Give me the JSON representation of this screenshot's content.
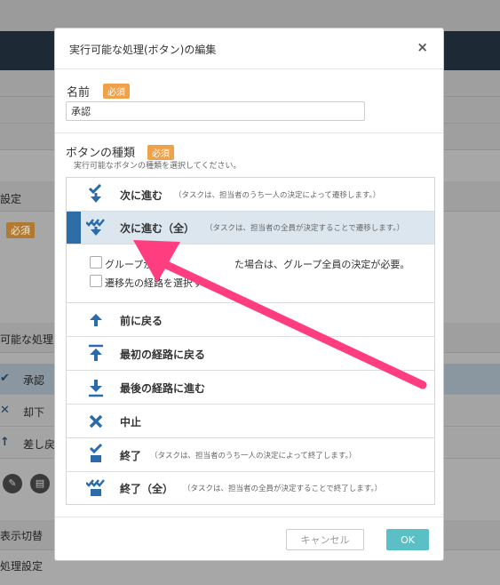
{
  "background": {
    "section_setting": "設定",
    "required_badge": "必須",
    "section_actions": "可能な処理(ボ",
    "rows": [
      {
        "icon": "✔",
        "label": "承認"
      },
      {
        "icon": "✕",
        "label": "却下"
      },
      {
        "icon": "↑",
        "label": "差し戻"
      }
    ],
    "display_toggle": "表示切替",
    "process_setting": "処理設定"
  },
  "modal": {
    "title": "実行可能な処理(ボタン)の編集",
    "close_icon": "×",
    "name_label": "名前",
    "name_required": "必須",
    "name_value": "承認",
    "type_label": "ボタンの種類",
    "type_required": "必須",
    "type_hint": "実行可能なボタンの種類を選択してください。",
    "items": [
      {
        "label": "次に進む",
        "desc": "（タスクは、担当者のうち一人の決定によって遷移します。）"
      },
      {
        "label": "次に進む（全）",
        "desc": "（タスクは、担当者の全員が決定することで遷移します。）"
      },
      {
        "label": "前に戻る",
        "desc": ""
      },
      {
        "label": "最初の経路に戻る",
        "desc": ""
      },
      {
        "label": "最後の経路に進む",
        "desc": ""
      },
      {
        "label": "中止",
        "desc": ""
      },
      {
        "label": "終了",
        "desc": "（タスクは、担当者のうち一人の決定によって終了します。）"
      },
      {
        "label": "終了（全）",
        "desc": "（タスクは、担当者の全員が決定することで終了します。）"
      }
    ],
    "options": [
      {
        "label": "グループが",
        "label_rest": "た場合は、グループ全員の決定が必要。"
      },
      {
        "label": "遷移先の経路を選択す"
      }
    ],
    "cancel_label": "キャンセル",
    "ok_label": "OK"
  },
  "colors": {
    "icon_blue": "#2a6cab",
    "selected_bg": "#dbe6ee",
    "selected_bar": "#2e6ea6",
    "badge": "#f0a24a",
    "ok": "#5bc0c5",
    "annotation_arrow": "#ff3d7f"
  }
}
